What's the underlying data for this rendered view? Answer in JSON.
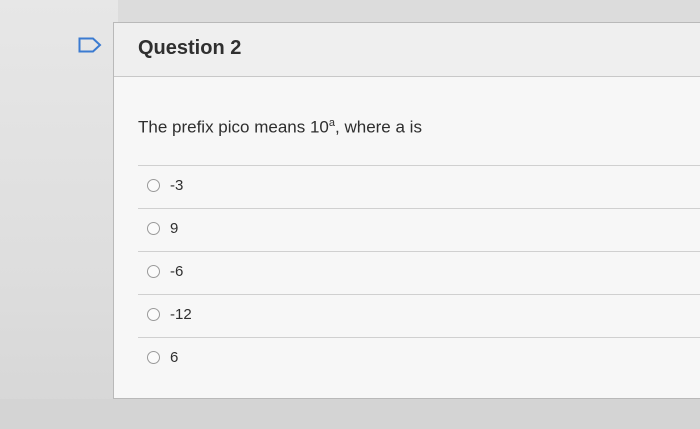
{
  "question": {
    "title": "Question 2",
    "text_prefix": "The prefix pico means 10",
    "text_superscript": "a",
    "text_suffix": ", where a is"
  },
  "answers": [
    {
      "label": "-3"
    },
    {
      "label": "9"
    },
    {
      "label": "-6"
    },
    {
      "label": "-12"
    },
    {
      "label": "6"
    }
  ],
  "colors": {
    "flag_outline": "#3b7bd1",
    "page_bg": "#dcdcdc",
    "card_bg": "#f7f7f7"
  },
  "icons": {
    "flag": "flag-icon"
  }
}
